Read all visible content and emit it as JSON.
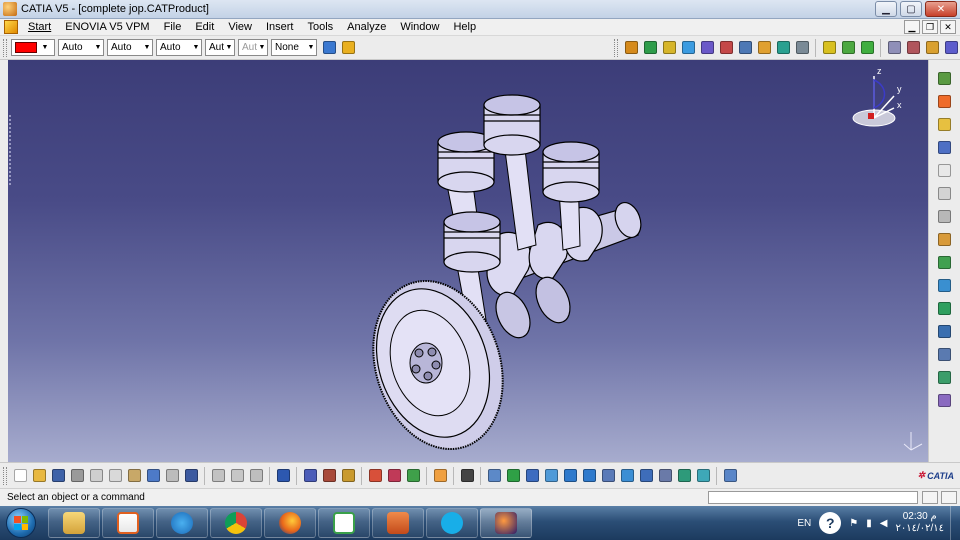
{
  "window": {
    "title": "CATIA V5 - [complete jop.CATProduct]",
    "controls": {
      "minimize": "▁",
      "maximize": "▢",
      "close": "✕"
    }
  },
  "menu": {
    "items": [
      "Start",
      "ENOVIA V5 VPM",
      "File",
      "Edit",
      "View",
      "Insert",
      "Tools",
      "Analyze",
      "Window",
      "Help"
    ],
    "mdi": {
      "minimize": "▁",
      "restore": "❐",
      "close": "✕"
    }
  },
  "properties_toolbar": {
    "fill_color": "#ff0000",
    "combos": [
      {
        "name": "linetype",
        "value": "Auto",
        "disabled": false
      },
      {
        "name": "thickness",
        "value": "Auto",
        "disabled": false
      },
      {
        "name": "layer-auto",
        "value": "Auto",
        "disabled": false
      },
      {
        "name": "transparency",
        "value": "Aut",
        "disabled": false
      },
      {
        "name": "weight",
        "value": "Aut",
        "disabled": true
      },
      {
        "name": "layer",
        "value": "None",
        "disabled": false
      }
    ]
  },
  "compass": {
    "x": "x",
    "y": "y",
    "z": "z"
  },
  "status": {
    "message": "Select an object or a command"
  },
  "brand": {
    "logo_text": "CATIA"
  },
  "taskbar": {
    "lang": "EN",
    "help": "?",
    "time": "02:30 م",
    "date": "٢٠١٤/٠٢/١٤"
  }
}
